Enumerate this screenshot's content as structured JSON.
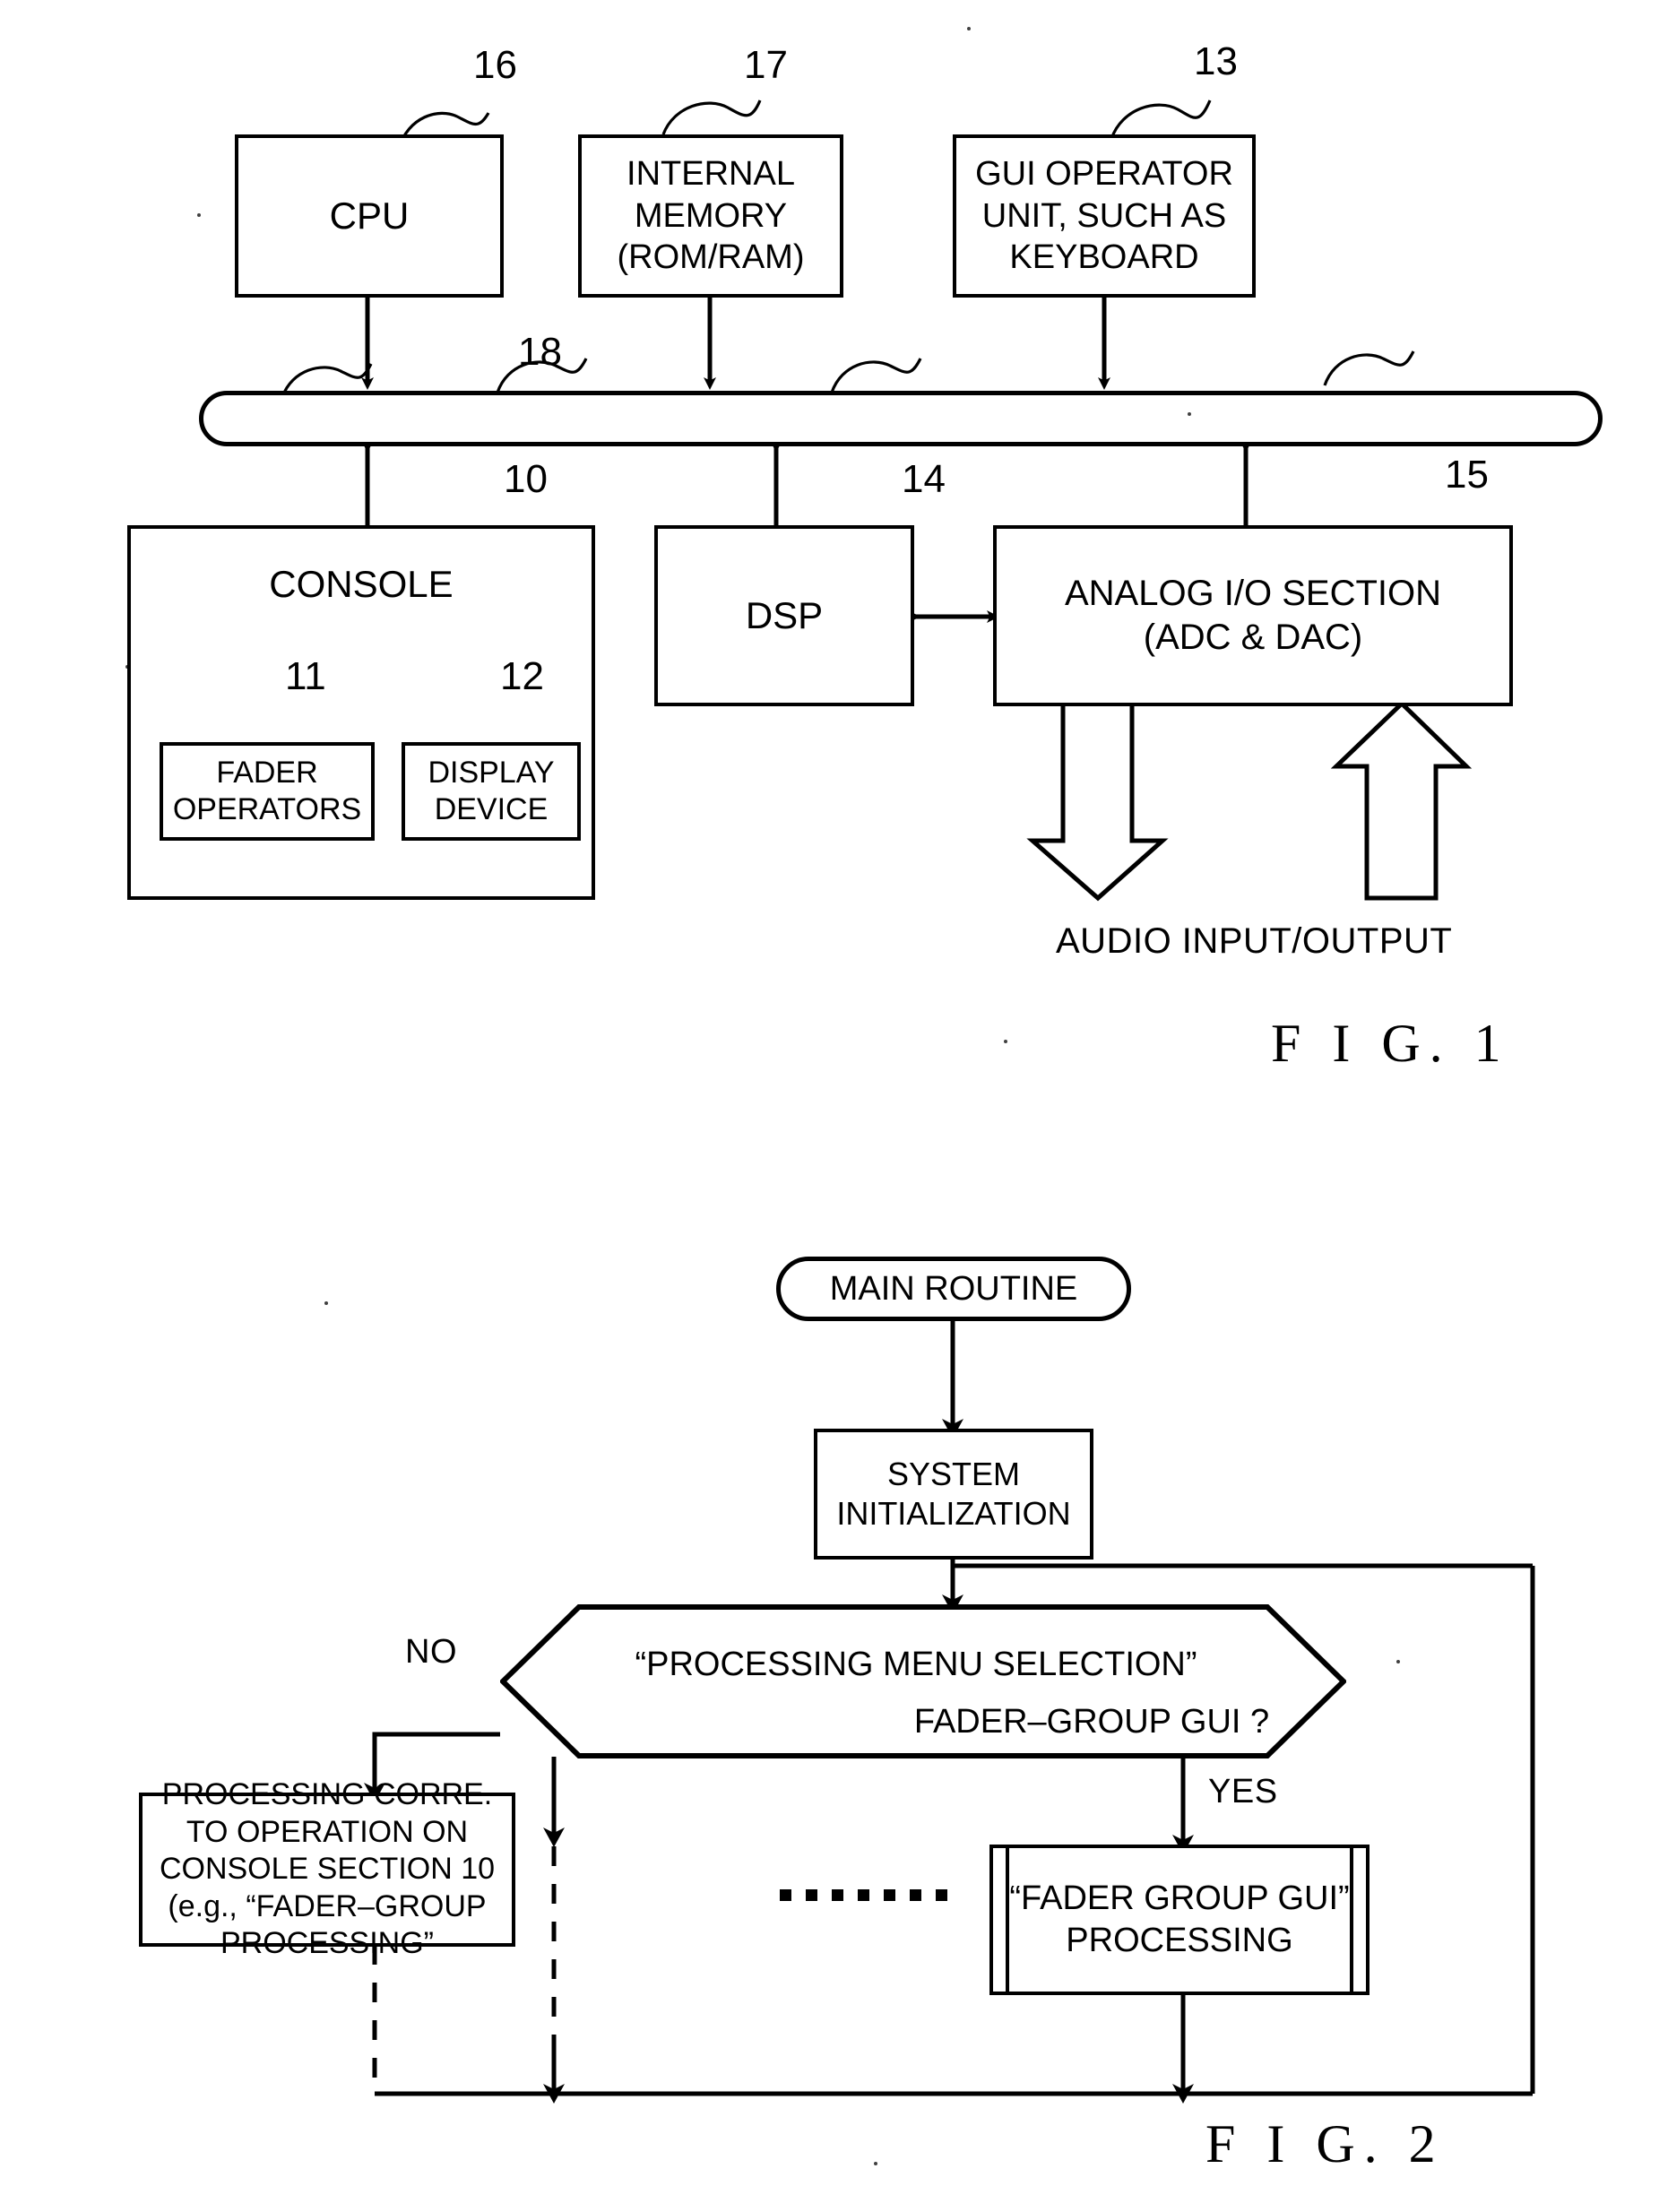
{
  "figure1": {
    "caption": "F I G.  1",
    "blocks": {
      "cpu": {
        "label": "CPU",
        "ref": "16"
      },
      "internal_memory": {
        "line1": "INTERNAL",
        "line2": "MEMORY",
        "line3": "(ROM/RAM)",
        "ref": "17"
      },
      "gui_operator": {
        "line1": "GUI OPERATOR",
        "line2": "UNIT, SUCH AS",
        "line3": "KEYBOARD",
        "ref": "13"
      },
      "bus": {
        "ref": "18"
      },
      "console": {
        "label": "CONSOLE",
        "ref": "10"
      },
      "fader_operators": {
        "line1": "FADER",
        "line2": "OPERATORS",
        "ref": "11"
      },
      "display_device": {
        "line1": "DISPLAY",
        "line2": "DEVICE",
        "ref": "12"
      },
      "dsp": {
        "label": "DSP",
        "ref": "14"
      },
      "analog_io": {
        "line1": "ANALOG I/O SECTION",
        "line2": "(ADC & DAC)",
        "ref": "15"
      }
    },
    "audio_io_label": "AUDIO INPUT/OUTPUT"
  },
  "figure2": {
    "caption": "F I G.  2",
    "start": {
      "label": "MAIN ROUTINE"
    },
    "init": {
      "line1": "SYSTEM",
      "line2": "INITIALIZATION"
    },
    "decision": {
      "line1": "“PROCESSING MENU SELECTION”",
      "line2": "FADER–GROUP GUI ?",
      "no_label": "NO",
      "yes_label": "YES"
    },
    "left_process": {
      "line1": "PROCESSING CORRE.",
      "line2": "TO OPERATION ON",
      "line3": "CONSOLE SECTION 10",
      "line4": "(e.g., “FADER–GROUP",
      "line5": "PROCESSING”"
    },
    "right_process": {
      "line1": "“FADER GROUP GUI”",
      "line2": "PROCESSING"
    },
    "ellipsis_dots": 7
  }
}
